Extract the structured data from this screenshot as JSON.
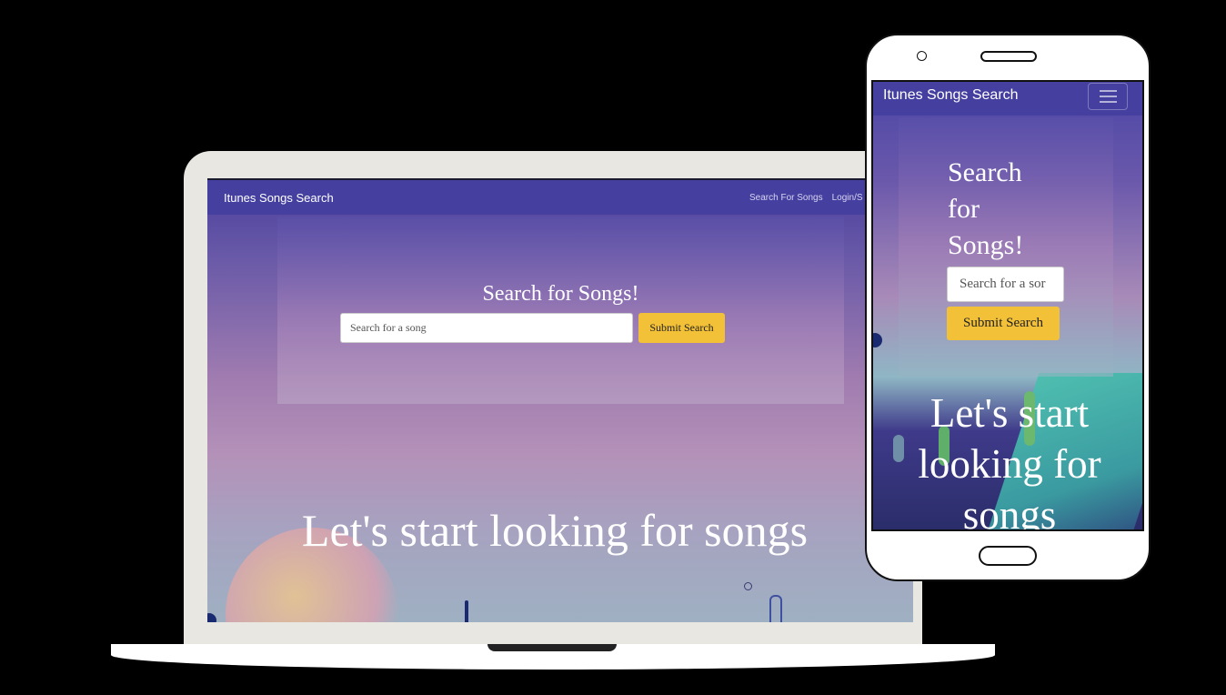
{
  "laptop": {
    "brand": "Itunes Songs Search",
    "nav_links": [
      "Search For Songs",
      "Login/S"
    ],
    "search_card": {
      "title": "Search for Songs!",
      "input_placeholder": "Search for a song",
      "submit_label": "Submit Search"
    },
    "hero_text": "Let's start looking for songs"
  },
  "phone": {
    "brand": "Itunes Songs Search",
    "menu_icon": "hamburger-menu-icon",
    "search_card": {
      "title": "Search for Songs!",
      "input_placeholder": "Search for a sor",
      "submit_label": "Submit Search"
    },
    "hero_text": "Let's start looking for songs"
  },
  "colors": {
    "navbar": "#4540a0",
    "button": "#f3c137",
    "frame_background": "#000000"
  }
}
